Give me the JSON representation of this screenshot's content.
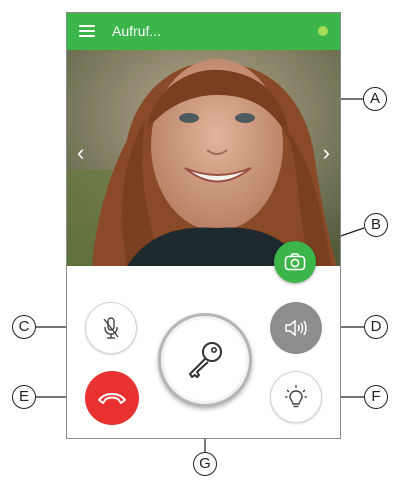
{
  "header": {
    "title": "Aufruf..."
  },
  "video": {
    "prev_arrow": "‹",
    "next_arrow": "›"
  },
  "callouts": {
    "a": "A",
    "b": "B",
    "c": "C",
    "d": "D",
    "e": "E",
    "f": "F",
    "g": "G"
  },
  "colors": {
    "accent": "#3cb54a",
    "hangup": "#e8322f",
    "speaker": "#8e8e8e",
    "status": "#a6dc55"
  },
  "icons": {
    "menu": "menu-icon",
    "snapshot": "camera-icon",
    "mute": "microphone-off-icon",
    "speaker": "speaker-icon",
    "hangup": "phone-hangup-icon",
    "door": "key-icon",
    "light": "lightbulb-icon"
  }
}
